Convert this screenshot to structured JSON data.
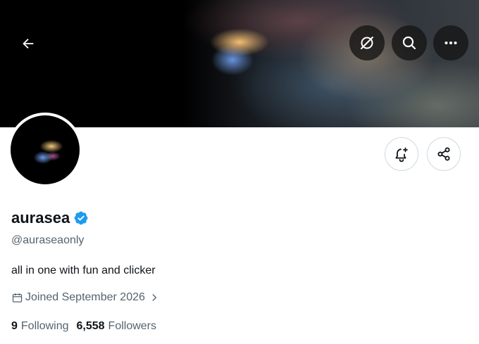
{
  "profile": {
    "display_name": "aurasea",
    "handle": "@auraseaonly",
    "bio": "all in one with fun and clicker",
    "joined": "Joined September 2026",
    "following_count": "9",
    "following_label": "Following",
    "followers_count": "6,558",
    "followers_label": "Followers",
    "verified": true
  },
  "header": {
    "icons": [
      "back-arrow-icon",
      "translate-off-icon",
      "search-icon",
      "more-icon"
    ]
  },
  "actions": {
    "icons": [
      "notification-add-icon",
      "share-icon"
    ]
  },
  "colors": {
    "verified_badge": "#1d9bf0",
    "secondary_text": "#536471",
    "primary_text": "#0f1419",
    "button_border": "#cfd9de"
  }
}
